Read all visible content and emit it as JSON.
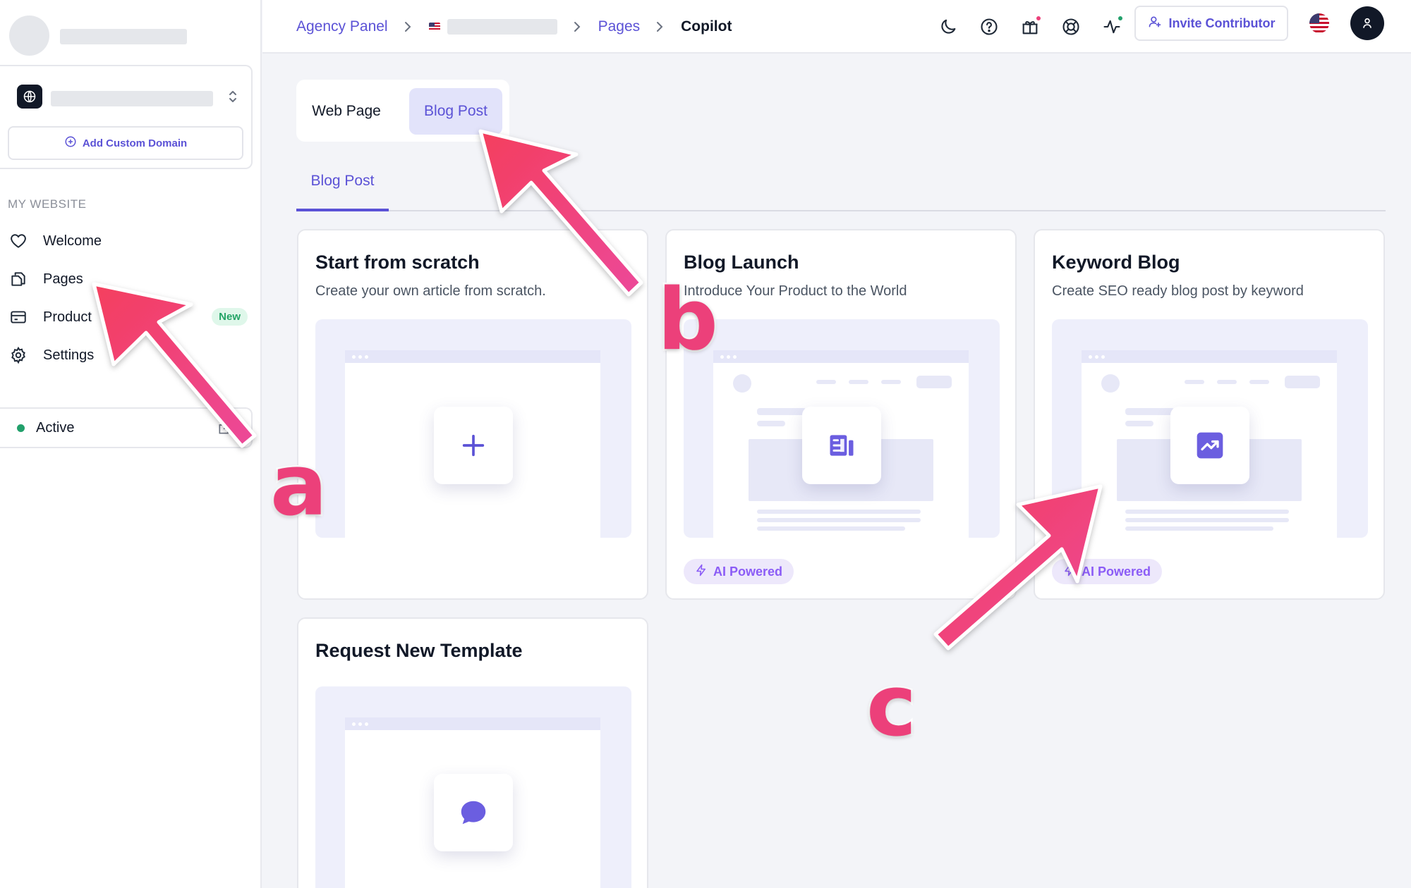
{
  "sidebar": {
    "add_domain_label": "Add Custom Domain",
    "section_label": "MY WEBSITE",
    "items": [
      {
        "label": "Welcome",
        "icon": "heart-icon"
      },
      {
        "label": "Pages",
        "icon": "pages-icon"
      },
      {
        "label": "Product",
        "icon": "card-icon",
        "badge": "New"
      },
      {
        "label": "Settings",
        "icon": "gear-icon"
      }
    ],
    "status_label": "Active"
  },
  "topbar": {
    "breadcrumb": {
      "root": "Agency Panel",
      "pages": "Pages",
      "current": "Copilot"
    },
    "invite_label": "Invite Contributor"
  },
  "content": {
    "segmented": {
      "web": "Web Page",
      "blog": "Blog Post"
    },
    "subtab": "Blog Post",
    "cards": [
      {
        "title": "Start from scratch",
        "desc": "Create your own article from scratch.",
        "icon": "plus-icon"
      },
      {
        "title": "Blog Launch",
        "desc": "Introduce Your Product to the World",
        "icon": "article-icon",
        "badge": "AI Powered"
      },
      {
        "title": "Keyword Blog",
        "desc": "Create SEO ready blog post by keyword",
        "icon": "trending-icon",
        "badge": "AI Powered"
      },
      {
        "title": "Request New Template",
        "icon": "chat-bubble-icon"
      }
    ]
  },
  "annotations": {
    "a": "a",
    "b": "b",
    "c": "c"
  },
  "colors": {
    "accent": "#5b52d6",
    "arrow": "#ec407a",
    "status_green": "#22a06b",
    "new_badge": "#23a466",
    "ai_badge": "#8b5cf6"
  }
}
